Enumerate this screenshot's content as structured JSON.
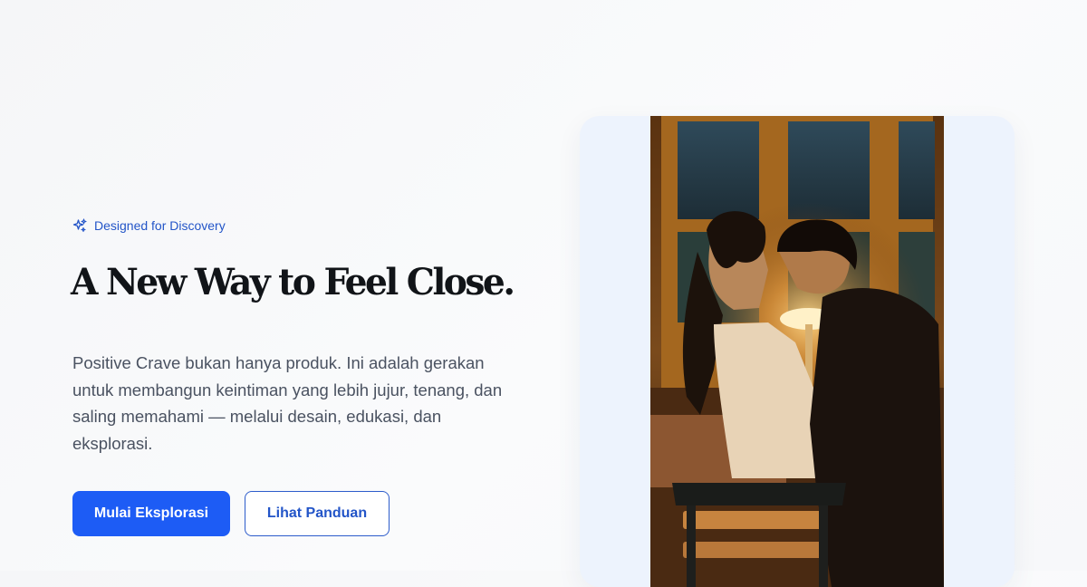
{
  "hero": {
    "eyebrow": {
      "icon": "sparkle-icon",
      "label": "Designed for Discovery"
    },
    "headline": "A New Way to Feel Close.",
    "description": "Positive Crave bukan hanya produk. Ini adalah gerakan untuk membangun keintiman yang lebih jujur, tenang, dan saling memahami — melalui desain, edukasi, dan eksplorasi.",
    "primary_cta": "Mulai Eksplorasi",
    "secondary_cta": "Lihat Panduan"
  },
  "colors": {
    "accent": "#1d5cf5",
    "accent_text": "#2355c8",
    "headline": "#111418",
    "body_text": "#4a5261",
    "card_background": "#edf3fd"
  }
}
